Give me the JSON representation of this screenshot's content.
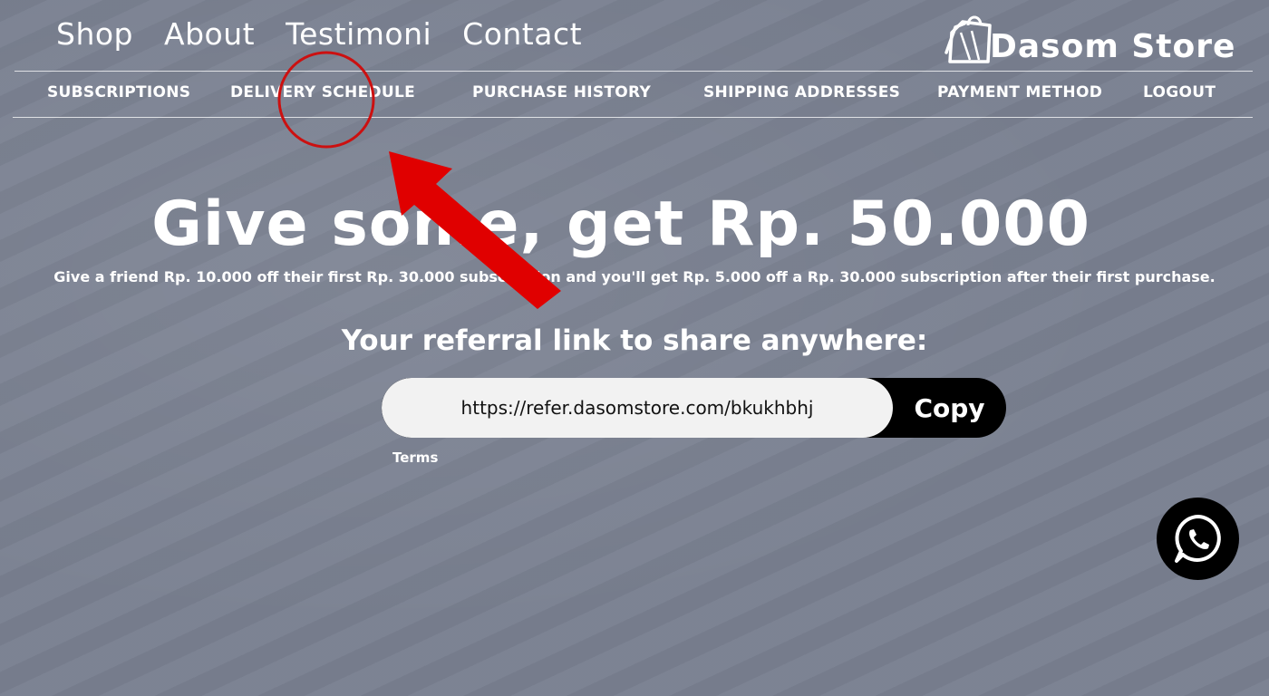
{
  "top_nav": {
    "shop": "Shop",
    "about": "About",
    "testimoni": "Testimoni",
    "contact": "Contact"
  },
  "brand": {
    "name": "Dasom Store",
    "icon": "shopping-bag-icon"
  },
  "sub_nav": {
    "subscriptions": "SUBSCRIPTIONS",
    "delivery_schedule": "DELIVERY SCHEDULE",
    "purchase_history": "PURCHASE HISTORY",
    "shipping_addresses": "SHIPPING ADDRESSES",
    "payment_method": "PAYMENT METHOD",
    "logout": "LOGOUT"
  },
  "hero": {
    "title": "Give some, get Rp. 50.000",
    "subtitle": "Give a friend Rp. 10.000 off their first Rp. 30.000 subscription and you'll get Rp. 5.000 off a Rp. 30.000 subscription after their first purchase."
  },
  "referral": {
    "heading": "Your referral link to share anywhere:",
    "link": "https://refer.dasomstore.com/bkukhbhj",
    "copy_label": "Copy",
    "terms_label": "Terms"
  },
  "annotation": {
    "color": "#e00000",
    "target": "DELIVERY SCHEDULE"
  },
  "whatsapp": {
    "icon": "whatsapp-icon"
  },
  "colors": {
    "background": "#7a8191",
    "text": "#ffffff",
    "input_bg": "#f2f2f2",
    "button_bg": "#000000"
  }
}
